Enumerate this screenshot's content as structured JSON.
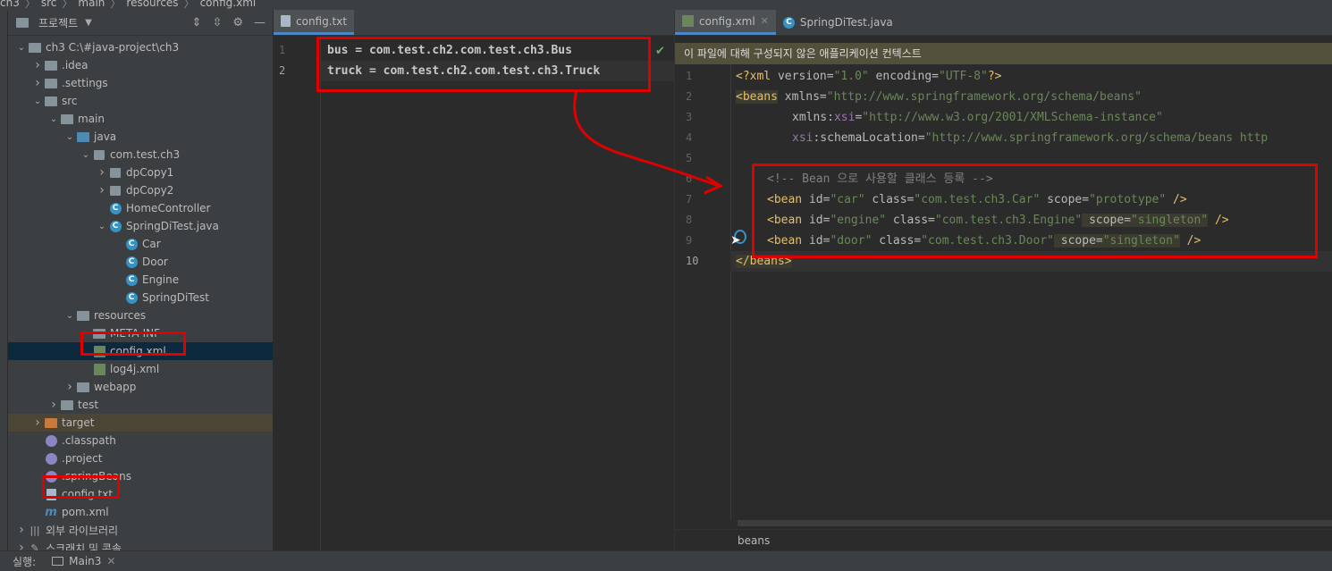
{
  "breadcrumb": [
    "ch3",
    "src",
    "main",
    "resources",
    "config.xml"
  ],
  "project_panel": {
    "title": "프로젝트",
    "tree": [
      {
        "label": "ch3  C:\\#java-project\\ch3",
        "depth": 0,
        "arrow": "open",
        "icon": "folder"
      },
      {
        "label": ".idea",
        "depth": 1,
        "arrow": "closed",
        "icon": "folder"
      },
      {
        "label": ".settings",
        "depth": 1,
        "arrow": "closed",
        "icon": "folder"
      },
      {
        "label": "src",
        "depth": 1,
        "arrow": "open",
        "icon": "folder"
      },
      {
        "label": "main",
        "depth": 2,
        "arrow": "open",
        "icon": "folder"
      },
      {
        "label": "java",
        "depth": 3,
        "arrow": "open",
        "icon": "folder-blue"
      },
      {
        "label": "com.test.ch3",
        "depth": 4,
        "arrow": "open",
        "icon": "package"
      },
      {
        "label": "dpCopy1",
        "depth": 5,
        "arrow": "closed",
        "icon": "package"
      },
      {
        "label": "dpCopy2",
        "depth": 5,
        "arrow": "closed",
        "icon": "package"
      },
      {
        "label": "HomeController",
        "depth": 5,
        "arrow": "none",
        "icon": "class"
      },
      {
        "label": "SpringDiTest.java",
        "depth": 5,
        "arrow": "open",
        "icon": "class"
      },
      {
        "label": "Car",
        "depth": 6,
        "arrow": "none",
        "icon": "class"
      },
      {
        "label": "Door",
        "depth": 6,
        "arrow": "none",
        "icon": "class"
      },
      {
        "label": "Engine",
        "depth": 6,
        "arrow": "none",
        "icon": "class"
      },
      {
        "label": "SpringDiTest",
        "depth": 6,
        "arrow": "none",
        "icon": "class"
      },
      {
        "label": "resources",
        "depth": 3,
        "arrow": "open",
        "icon": "folder"
      },
      {
        "label": "META-INF",
        "depth": 4,
        "arrow": "none",
        "icon": "folder"
      },
      {
        "label": "config.xml",
        "depth": 4,
        "arrow": "none",
        "icon": "xml",
        "selected": true
      },
      {
        "label": "log4j.xml",
        "depth": 4,
        "arrow": "none",
        "icon": "xml"
      },
      {
        "label": "webapp",
        "depth": 3,
        "arrow": "closed",
        "icon": "folder"
      },
      {
        "label": "test",
        "depth": 2,
        "arrow": "closed",
        "icon": "folder"
      },
      {
        "label": "target",
        "depth": 1,
        "arrow": "closed",
        "icon": "folder-orange",
        "target": true
      },
      {
        "label": ".classpath",
        "depth": 1,
        "arrow": "none",
        "icon": "eclipse"
      },
      {
        "label": ".project",
        "depth": 1,
        "arrow": "none",
        "icon": "eclipse"
      },
      {
        "label": ".springBeans",
        "depth": 1,
        "arrow": "none",
        "icon": "eclipse"
      },
      {
        "label": "config.txt",
        "depth": 1,
        "arrow": "none",
        "icon": "file"
      },
      {
        "label": "pom.xml",
        "depth": 1,
        "arrow": "none",
        "icon": "maven"
      },
      {
        "label": "외부 라이브러리",
        "depth": 0,
        "arrow": "closed",
        "icon": "library"
      },
      {
        "label": "스크래치 및 콘솔",
        "depth": 0,
        "arrow": "closed",
        "icon": "scratch"
      }
    ]
  },
  "editor_mid": {
    "tab": "config.txt",
    "lines": [
      "bus = com.test.ch2.com.test.ch3.Bus",
      "truck = com.test.ch2.com.test.ch3.Truck"
    ],
    "line_numbers": [
      "1",
      "2"
    ]
  },
  "editor_right": {
    "tabs": [
      {
        "label": "config.xml",
        "active": true
      },
      {
        "label": "SpringDiTest.java",
        "active": false
      }
    ],
    "notice": "이 파일에 대해 구성되지 않은 애플리케이션 컨텍스트",
    "line_numbers": [
      "1",
      "2",
      "3",
      "4",
      "5",
      "6",
      "7",
      "8",
      "9",
      "10"
    ],
    "code": {
      "l1_a": "<?xml ",
      "l1_b": "version=",
      "l1_c": "\"1.0\"",
      "l1_d": " encoding=",
      "l1_e": "\"UTF-8\"",
      "l1_f": "?>",
      "l2_a": "<beans",
      "l2_b": " xmlns=",
      "l2_c": "\"http://www.springframework.org/schema/beans\"",
      "l3_a": "xmlns:",
      "l3_b": "xsi",
      "l3_c": "=",
      "l3_d": "\"http://www.w3.org/2001/XMLSchema-instance\"",
      "l4_a": "xsi",
      "l4_b": ":schemaLocation=",
      "l4_c": "\"http://www.springframework.org/schema/beans http",
      "l6": "<!-- Bean 으로 사용할 클래스 등록 -->",
      "l7_a": "<bean",
      "l7_b": " id=",
      "l7_c": "\"car\"",
      "l7_d": " class=",
      "l7_e": "\"com.test.ch3.Car\"",
      "l7_f": " scope=",
      "l7_g": "\"prototype\"",
      "l7_h": " />",
      "l8_a": "<bean",
      "l8_b": " id=",
      "l8_c": "\"engine\"",
      "l8_d": " class=",
      "l8_e": "\"com.test.ch3.Engine\"",
      "l8_f": " scope=",
      "l8_g": "\"singleton\"",
      "l8_h": " />",
      "l9_a": "<bean",
      "l9_b": " id=",
      "l9_c": "\"door\"",
      "l9_d": " class=",
      "l9_e": "\"com.test.ch3.Door\"",
      "l9_f": " scope=",
      "l9_g": "\"singleton\"",
      "l9_h": " />",
      "l10": "</beans>"
    },
    "status": "beans"
  },
  "bottom_bar": {
    "run_label": "실행:",
    "run_tab": "Main3"
  },
  "colors": {
    "annotation_red": "#e00000",
    "selection": "#0d293e",
    "accent": "#4a88c7"
  }
}
